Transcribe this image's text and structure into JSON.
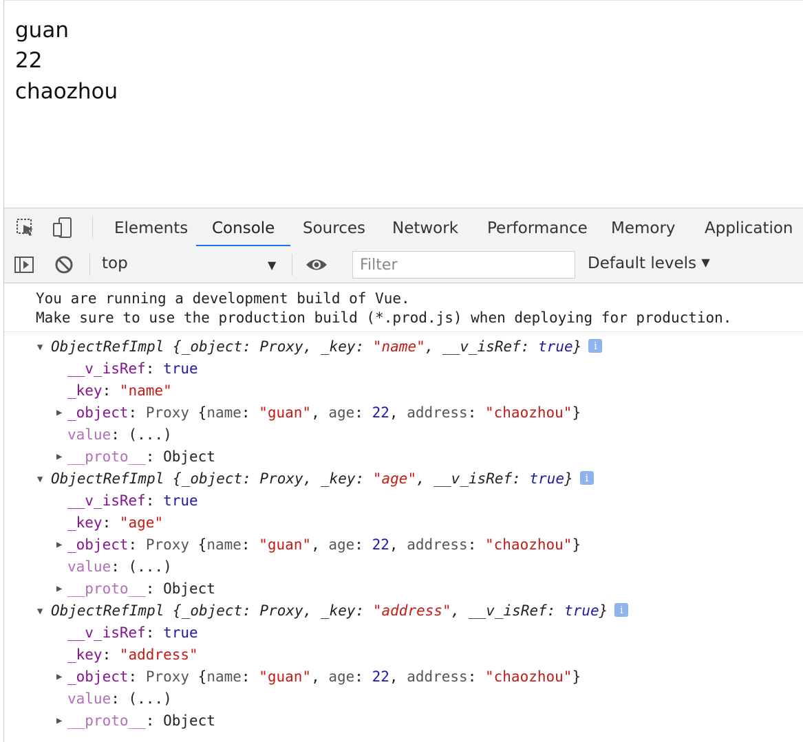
{
  "page": {
    "lines": [
      "guan",
      "22",
      "chaozhou"
    ]
  },
  "devtools": {
    "tabs": [
      "Elements",
      "Console",
      "Sources",
      "Network",
      "Performance",
      "Memory",
      "Application"
    ],
    "active_tab": "Console",
    "context": "top",
    "filter_placeholder": "Filter",
    "levels": "Default levels",
    "accent": "#1a73e8"
  },
  "console": {
    "vue_message": [
      "You are running a development build of Vue.",
      "Make sure to use the production build (*.prod.js) when deploying for production."
    ],
    "entries": [
      {
        "class": "ObjectRefImpl",
        "summary": {
          "object_key": "_object",
          "object_val": "Proxy",
          "key_key": "_key",
          "key_val": "\"name\"",
          "isref_key": "__v_isRef",
          "isref_val": "true"
        },
        "isref": {
          "key": "__v_isRef",
          "val": "true"
        },
        "key": {
          "key": "_key",
          "val": "\"name\""
        },
        "object": {
          "key": "_object",
          "proxy": "Proxy",
          "name_k": "name",
          "name_v": "\"guan\"",
          "age_k": "age",
          "age_v": "22",
          "addr_k": "address",
          "addr_v": "\"chaozhou\""
        },
        "value": {
          "key": "value",
          "val": "(...)"
        },
        "proto": {
          "key": "__proto__",
          "val": "Object"
        }
      },
      {
        "class": "ObjectRefImpl",
        "summary": {
          "object_key": "_object",
          "object_val": "Proxy",
          "key_key": "_key",
          "key_val": "\"age\"",
          "isref_key": "__v_isRef",
          "isref_val": "true"
        },
        "isref": {
          "key": "__v_isRef",
          "val": "true"
        },
        "key": {
          "key": "_key",
          "val": "\"age\""
        },
        "object": {
          "key": "_object",
          "proxy": "Proxy",
          "name_k": "name",
          "name_v": "\"guan\"",
          "age_k": "age",
          "age_v": "22",
          "addr_k": "address",
          "addr_v": "\"chaozhou\""
        },
        "value": {
          "key": "value",
          "val": "(...)"
        },
        "proto": {
          "key": "__proto__",
          "val": "Object"
        }
      },
      {
        "class": "ObjectRefImpl",
        "summary": {
          "object_key": "_object",
          "object_val": "Proxy",
          "key_key": "_key",
          "key_val": "\"address\"",
          "isref_key": "__v_isRef",
          "isref_val": "true"
        },
        "isref": {
          "key": "__v_isRef",
          "val": "true"
        },
        "key": {
          "key": "_key",
          "val": "\"address\""
        },
        "object": {
          "key": "_object",
          "proxy": "Proxy",
          "name_k": "name",
          "name_v": "\"guan\"",
          "age_k": "age",
          "age_v": "22",
          "addr_k": "address",
          "addr_v": "\"chaozhou\""
        },
        "value": {
          "key": "value",
          "val": "(...)"
        },
        "proto": {
          "key": "__proto__",
          "val": "Object"
        }
      }
    ]
  }
}
